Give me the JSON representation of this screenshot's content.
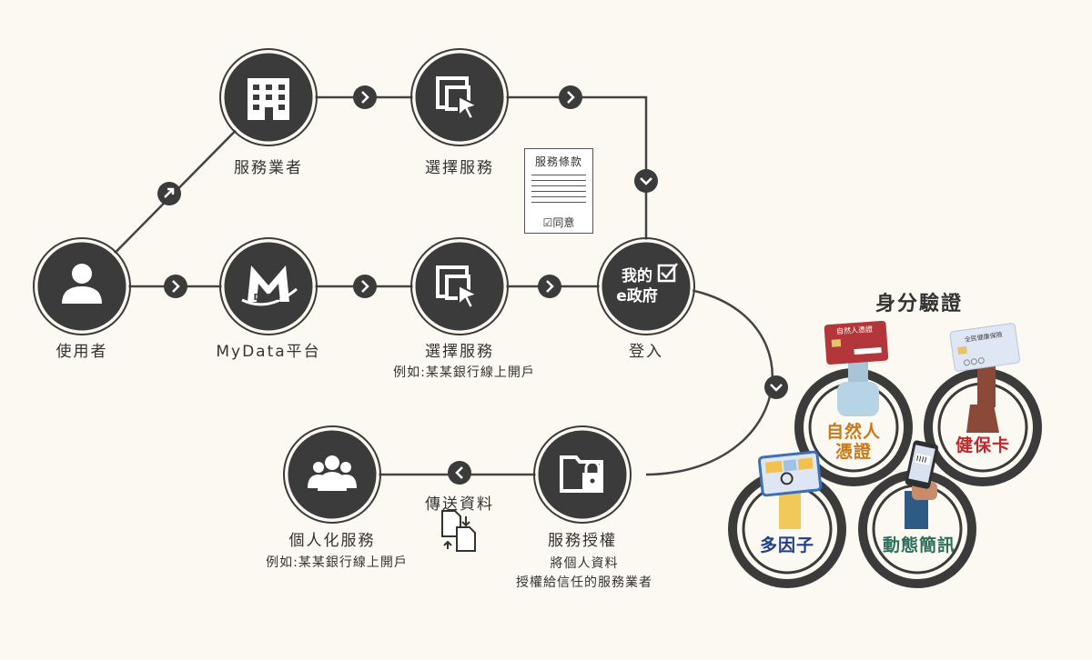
{
  "nodes": {
    "user": {
      "label": "使用者"
    },
    "provider": {
      "label": "服務業者"
    },
    "select_top": {
      "label": "選擇服務"
    },
    "mydata": {
      "label": "MyData平台",
      "logo_text": "DATA"
    },
    "select_mid": {
      "label": "選擇服務",
      "sub": "例如:某某銀行線上開戶"
    },
    "egov": {
      "label": "登入",
      "inner_line1": "我的",
      "inner_line2": "e政府"
    },
    "authorize": {
      "label": "服務授權",
      "sub1": "將個人資料",
      "sub2": "授權給信任的服務業者"
    },
    "personal": {
      "label": "個人化服務",
      "sub": "例如:某某銀行線上開戶"
    }
  },
  "transfer": {
    "label": "傳送資料"
  },
  "terms_doc": {
    "title": "服務條款",
    "agree": "同意"
  },
  "identity": {
    "title": "身分驗證",
    "methods": [
      {
        "line1": "自然人",
        "line2": "憑證",
        "color": "#c7791d",
        "card_text": "自然人憑證"
      },
      {
        "line1": "健保卡",
        "line2": "",
        "color": "#c1272d",
        "card_text": "全民健康保險"
      },
      {
        "line1": "多因子",
        "line2": "",
        "color": "#1f3f8c"
      },
      {
        "line1": "動態簡訊",
        "line2": "",
        "color": "#2e6f5e"
      }
    ]
  },
  "colors": {
    "node": "#3b3b3b",
    "line": "#444444",
    "bg": "#fbf9f1"
  }
}
